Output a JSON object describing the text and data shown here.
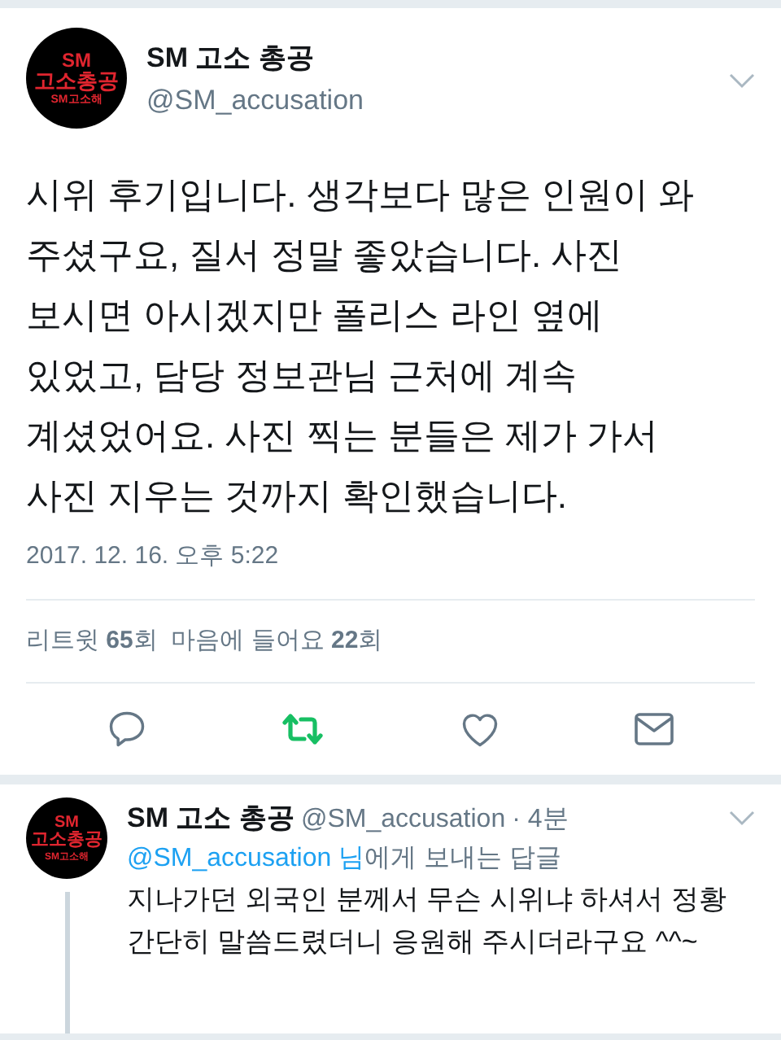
{
  "tweet": {
    "avatar": {
      "line1": "SM",
      "line2": "고소총공",
      "line3": "SM고소해"
    },
    "name": "SM 고소 총공",
    "handle": "@SM_accusation",
    "text": "시위 후기입니다. 생각보다 많은 인원이 와\n주셨구요, 질서 정말 좋았습니다. 사진\n보시면 아시겠지만 폴리스 라인 옆에\n있었고, 담당 정보관님 근처에 계속\n계셨었어요. 사진 찍는 분들은 제가 가서\n사진 지우는 것까지 확인했습니다.",
    "timestamp": "2017. 12. 16. 오후 5:22",
    "stats": "리트윗 **65**회  마음에 들어요 **22**회",
    "retweeted": true,
    "liked": false
  },
  "reply": {
    "avatar": {
      "line1": "SM",
      "line2": "고소총공",
      "line3": "SM고소해"
    },
    "name": "SM 고소 총공",
    "handle": "@SM_accusation",
    "time": "· 4분",
    "replying_to_handle": "@SM_accusation 님",
    "replying_to_rest": "에게 보내는 답글",
    "text": "지나가던 외국인 분께서 무슨 시위냐 하셔서 정황\n간단히 말씀드렸더니 응원해 주시더라구요 ^^~"
  }
}
